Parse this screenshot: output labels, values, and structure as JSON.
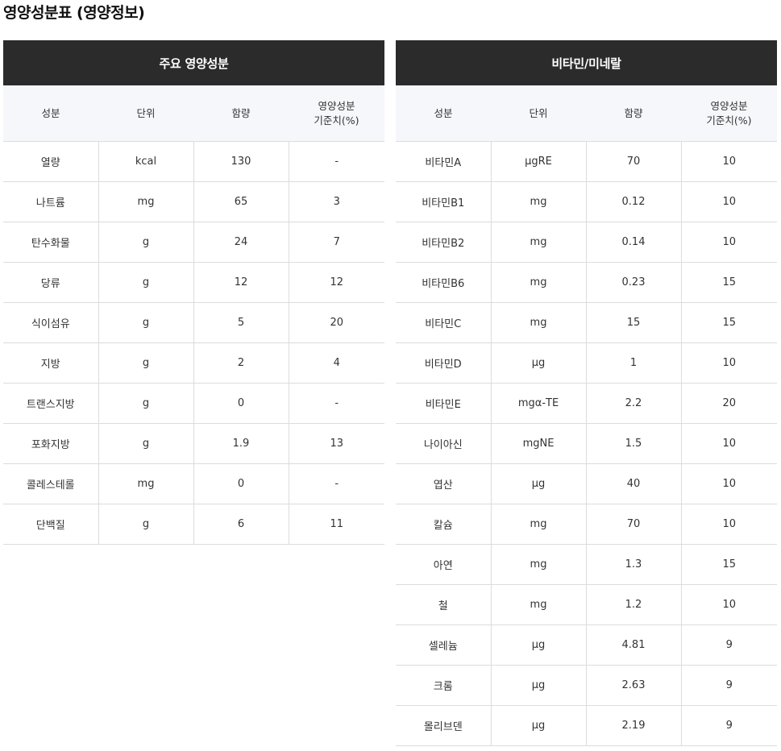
{
  "page_title": "영양성분표 (영양정보)",
  "main_table": {
    "title": "주요 영양성분",
    "headers": {
      "component": "성분",
      "unit": "단위",
      "amount": "함량",
      "dv_line1": "영양성분",
      "dv_line2": "기준치(%)"
    },
    "rows": [
      [
        "열량",
        "kcal",
        "130",
        "-"
      ],
      [
        "나트륨",
        "mg",
        "65",
        "3"
      ],
      [
        "탄수화물",
        "g",
        "24",
        "7"
      ],
      [
        "당류",
        "g",
        "12",
        "12"
      ],
      [
        "식이섬유",
        "g",
        "5",
        "20"
      ],
      [
        "지방",
        "g",
        "2",
        "4"
      ],
      [
        "트랜스지방",
        "g",
        "0",
        "-"
      ],
      [
        "포화지방",
        "g",
        "1.9",
        "13"
      ],
      [
        "콜레스테롤",
        "mg",
        "0",
        "-"
      ],
      [
        "단백질",
        "g",
        "6",
        "11"
      ]
    ]
  },
  "vitamin_table": {
    "title": "비타민/미네랄",
    "headers": {
      "component": "성분",
      "unit": "단위",
      "amount": "함량",
      "dv_line1": "영양성분",
      "dv_line2": "기준치(%)"
    },
    "rows": [
      [
        "비타민A",
        "μgRE",
        "70",
        "10"
      ],
      [
        "비타민B1",
        "mg",
        "0.12",
        "10"
      ],
      [
        "비타민B2",
        "mg",
        "0.14",
        "10"
      ],
      [
        "비타민B6",
        "mg",
        "0.23",
        "15"
      ],
      [
        "비타민C",
        "mg",
        "15",
        "15"
      ],
      [
        "비타민D",
        "μg",
        "1",
        "10"
      ],
      [
        "비타민E",
        "mgα-TE",
        "2.2",
        "20"
      ],
      [
        "나이아신",
        "mgNE",
        "1.5",
        "10"
      ],
      [
        "엽산",
        "μg",
        "40",
        "10"
      ],
      [
        "칼슘",
        "mg",
        "70",
        "10"
      ],
      [
        "아연",
        "mg",
        "1.3",
        "15"
      ],
      [
        "철",
        "mg",
        "1.2",
        "10"
      ],
      [
        "셀레늄",
        "μg",
        "4.81",
        "9"
      ],
      [
        "크롬",
        "μg",
        "2.63",
        "9"
      ],
      [
        "몰리브덴",
        "μg",
        "2.19",
        "9"
      ]
    ]
  }
}
